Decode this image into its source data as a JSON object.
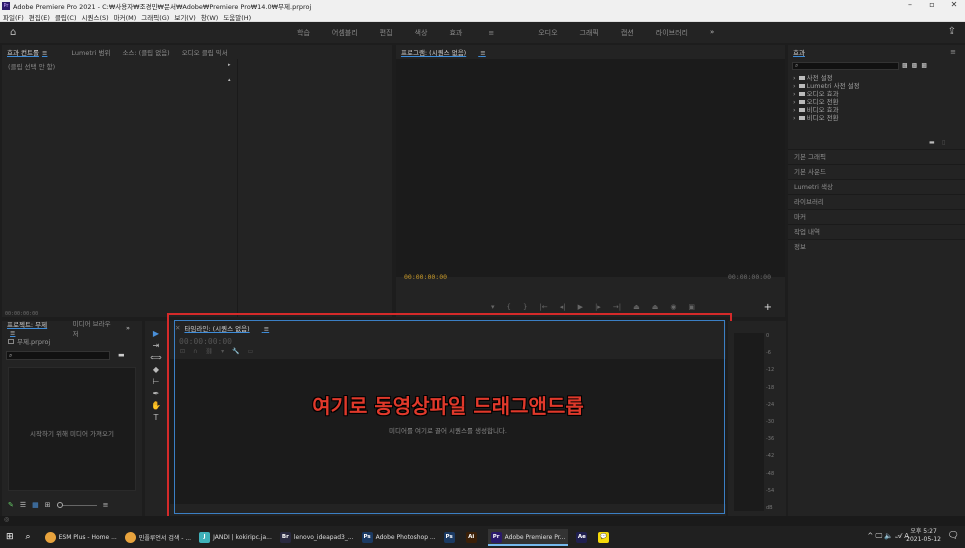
{
  "window": {
    "title": "Adobe Premiere Pro 2021 - C:₩사용자₩조경민₩문서₩Adobe₩Premiere Pro₩14.0₩무제.prproj",
    "app_icon": "Pr",
    "controls": [
      "–",
      "▫",
      "✕"
    ]
  },
  "menu": [
    "파일(F)",
    "편집(E)",
    "클립(C)",
    "시퀀스(S)",
    "마커(M)",
    "그래픽(G)",
    "보기(V)",
    "창(W)",
    "도움말(H)"
  ],
  "workspaces": {
    "tabs": [
      "학습",
      "어셈블리",
      "편집",
      "색상",
      "효과",
      "오디오",
      "그래픽",
      "캡션",
      "라이브러리"
    ],
    "active": "효과",
    "active_suffix": "≡",
    "more": "»"
  },
  "effect_controls": {
    "tabs": [
      "효과 컨트롤",
      "Lumetri 범위",
      "소스: (클립 없음)",
      "오디오 클립 믹서"
    ],
    "active_suffix": "≡",
    "no_clip": "(클립 선택 안 함)",
    "timecode": "00:00:00:00"
  },
  "program_monitor": {
    "title": "프로그램: (시퀀스 없음)",
    "title_suffix": "≡",
    "timecode_left": "00:00:00:00",
    "timecode_right": "00:00:00:00"
  },
  "effects_panel": {
    "title": "효과",
    "menu_icon": "≡",
    "search_icon": "⌕",
    "items": [
      "사전 설정",
      "Lumetri 사전 설정",
      "오디오 효과",
      "오디오 전환",
      "비디오 효과",
      "비디오 전환"
    ],
    "sections": [
      "기본 그래픽",
      "기본 사운드",
      "Lumetri 색상",
      "라이브러리",
      "마커",
      "작업 내역",
      "정보"
    ]
  },
  "project_panel": {
    "tabs": [
      "프로젝트: 무제",
      "미디어 브라우저"
    ],
    "active_suffix": "≡",
    "more": "»",
    "file": "무제.prproj",
    "search_icon": "⌕",
    "import_hint": "시작하기 위해 미디어 가져오기"
  },
  "timeline": {
    "title": "타임라인: (시퀀스 없음)",
    "title_suffix": "≡",
    "timecode": "00:00:00:00",
    "drop_hint": "미디어를 여기로 끌어 시퀀스를 생성합니다.",
    "overlay_text": "여기로 동영상파일 드래그앤드롭",
    "highlight_color": "#d42a2a"
  },
  "audio_meter": {
    "ticks": [
      "0",
      "-6",
      "-12",
      "-18",
      "-24",
      "-30",
      "-36",
      "-42",
      "-48",
      "-54",
      "dB"
    ]
  },
  "taskbar": {
    "items": [
      {
        "label": "ESM Plus - Home ...",
        "icon": "chrome-icon",
        "color": "#e8a33d"
      },
      {
        "label": "민플루언서 검색 - ...",
        "icon": "chrome-icon",
        "color": "#e8a33d"
      },
      {
        "label": "JANDI | kokiripc.ja...",
        "icon": "jandi-icon",
        "color": "#3fb1b9",
        "glyph": "J"
      },
      {
        "label": "lenovo_ideapad3_...",
        "icon": "bridge-icon",
        "color": "#2a2a40",
        "glyph": "Br"
      },
      {
        "label": "Adobe Photoshop ...",
        "icon": "photoshop-icon",
        "color": "#1b3a63",
        "glyph": "Ps"
      },
      {
        "label": "",
        "icon": "photoshop-icon",
        "color": "#1b3a63",
        "glyph": "Ps"
      },
      {
        "label": "",
        "icon": "illustrator-icon",
        "color": "#3b2008",
        "glyph": "Ai"
      },
      {
        "label": "Adobe Premiere Pr...",
        "icon": "premiere-icon",
        "color": "#2b1a6b",
        "glyph": "Pr"
      },
      {
        "label": "",
        "icon": "after-effects-icon",
        "color": "#1f1f4f",
        "glyph": "Ae"
      },
      {
        "label": "",
        "icon": "kakaotalk-icon",
        "color": "#f5d90a",
        "glyph": "💬"
      }
    ],
    "clock_time": "오후 5:27",
    "clock_date": "2021-05-12",
    "tray": "^ 🖵 🔈 𝒜 A"
  }
}
